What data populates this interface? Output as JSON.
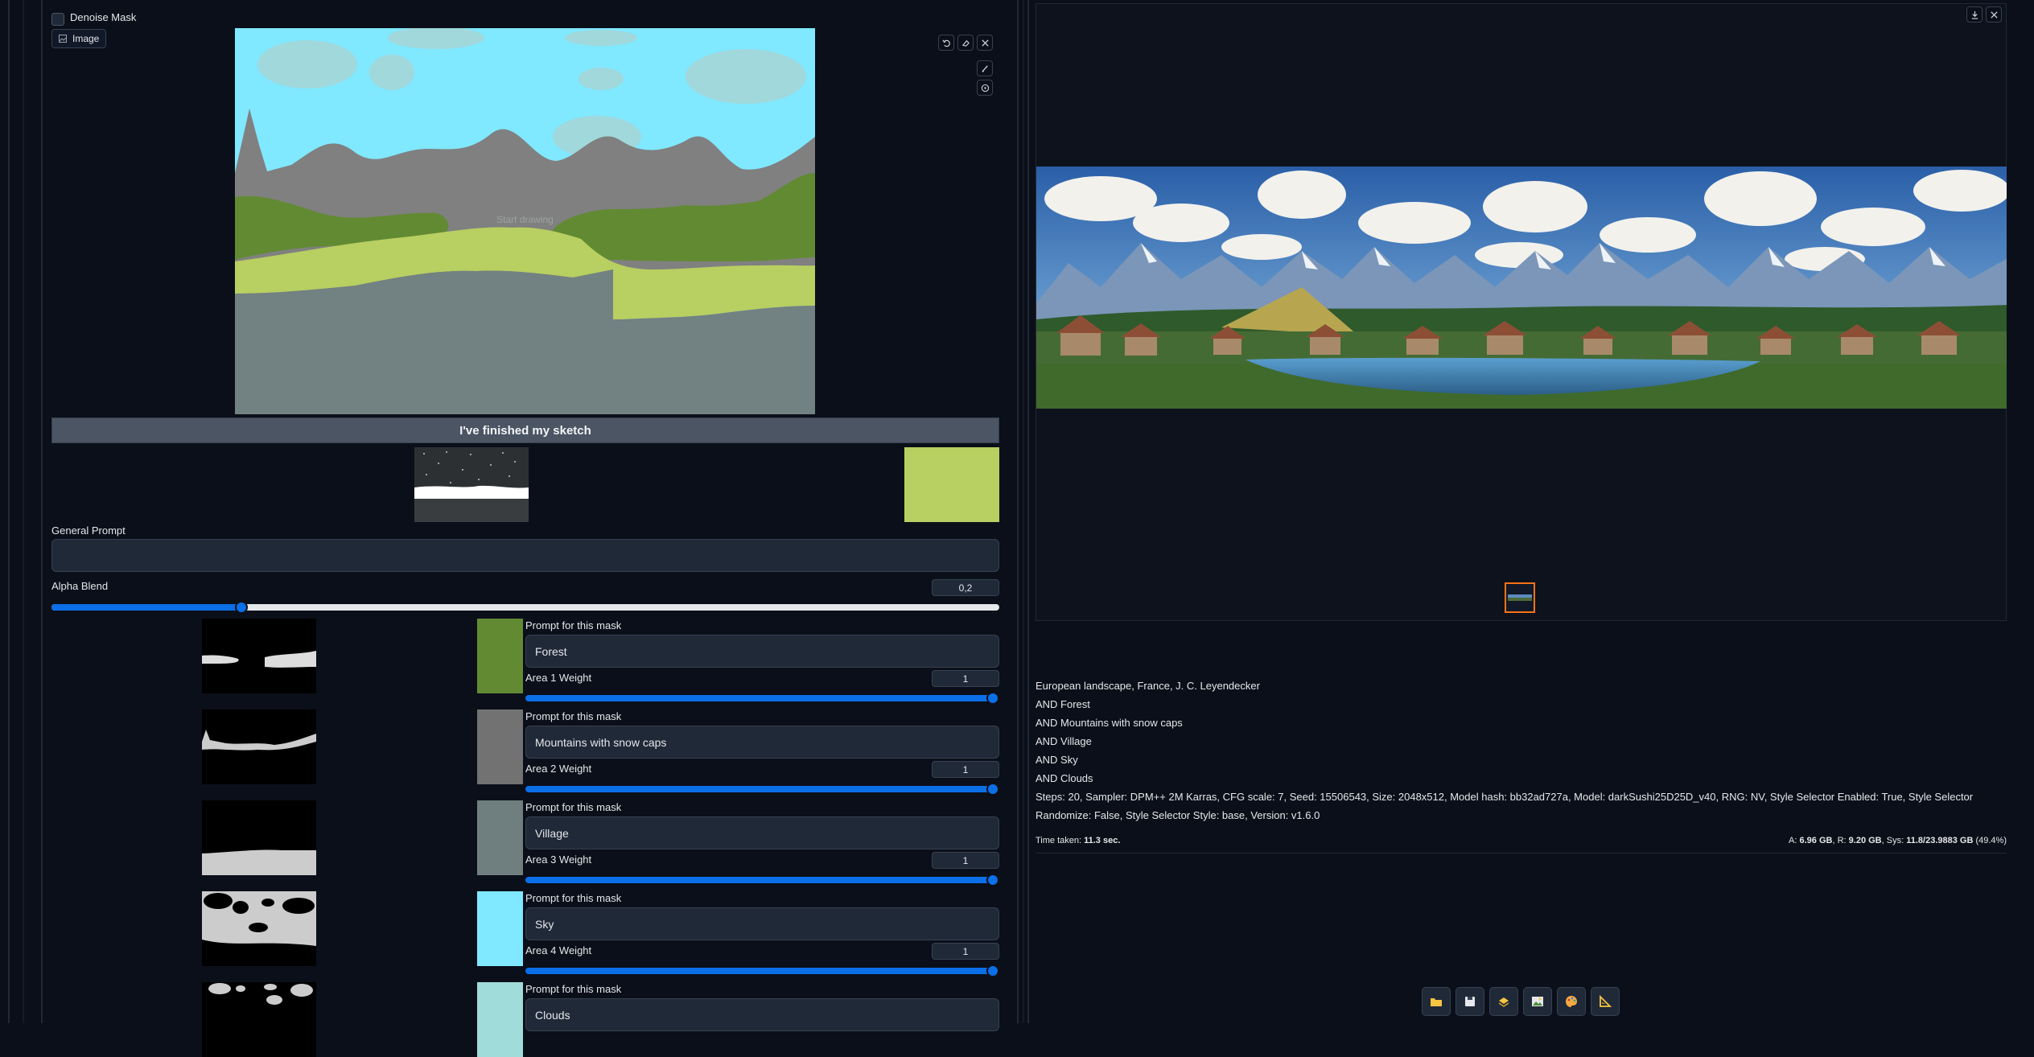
{
  "left": {
    "denoise_mask_label": "Denoise Mask",
    "image_tab_label": "Image",
    "canvas": {
      "placeholder": "Start drawing",
      "colors": {
        "sky": "#80e8ff",
        "clouds": "#a0d8dc",
        "mountains": "#808080",
        "forest": "#628a33",
        "village": "#b8cf61",
        "ground": "#728181"
      }
    },
    "finish_button_label": "I've finished my sketch",
    "selected_color": "#b8cf61",
    "general_prompt_label": "General Prompt",
    "general_prompt_value": "",
    "alpha_blend_label": "Alpha Blend",
    "alpha_blend_value": "0,2",
    "alpha_blend_fraction": 0.2,
    "prompt_label": "Prompt for this mask",
    "masks": [
      {
        "color": "#628a33",
        "prompt": "Forest",
        "weight_label": "Area 1 Weight",
        "weight": "1"
      },
      {
        "color": "#727272",
        "prompt": "Mountains with snow caps",
        "weight_label": "Area 2 Weight",
        "weight": "1"
      },
      {
        "color": "#6f7e7e",
        "prompt": "Village",
        "weight_label": "Area 3 Weight",
        "weight": "1"
      },
      {
        "color": "#80e8ff",
        "prompt": "Sky",
        "weight_label": "Area 4 Weight",
        "weight": "1"
      },
      {
        "color": "#a0dcda",
        "prompt": "Clouds",
        "weight_label": "",
        "weight": ""
      }
    ]
  },
  "right": {
    "generation_info": {
      "lines": [
        "European landscape, France, J. C. Leyendecker",
        "AND Forest",
        "AND Mountains with snow caps",
        "AND Village",
        "AND Sky",
        "AND Clouds"
      ],
      "params": "Steps: 20, Sampler: DPM++ 2M Karras, CFG scale: 7, Seed: 15506543, Size: 2048x512, Model hash: bb32ad727a, Model: darkSushi25D25D_v40, RNG: NV, Style Selector Enabled: True, Style Selector Randomize: False, Style Selector Style: base, Version: v1.6.0"
    },
    "time_label": "Time taken:",
    "time_value": "11.3 sec.",
    "mem": {
      "a_label": "A:",
      "a_value": "6.96 GB",
      "r_label": "R:",
      "r_value": "9.20 GB",
      "sys_label": "Sys:",
      "sys_value": "11.8/23.9883 GB",
      "sys_pct": "(49.4%)"
    },
    "toolbar_icons": [
      "folder-icon",
      "save-icon",
      "zip-icon",
      "image-icon",
      "palette-icon",
      "ruler-icon"
    ]
  }
}
